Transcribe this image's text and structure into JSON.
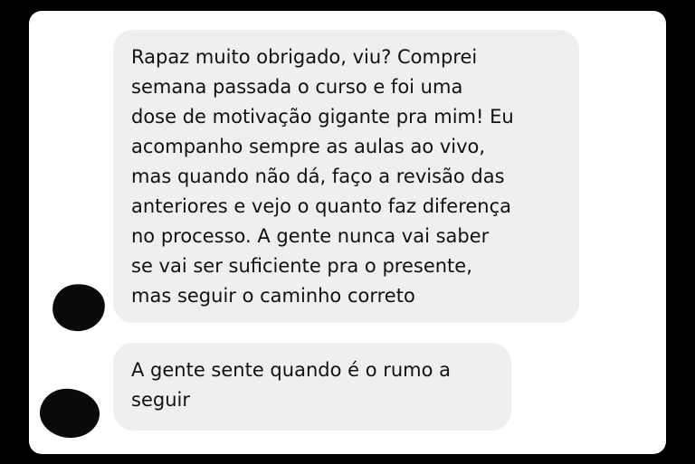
{
  "messages": [
    {
      "lines": [
        "Rapaz muito obrigado, viu? Comprei",
        "semana passada o curso e foi uma",
        "dose de motivação gigante pra mim! Eu",
        "acompanho sempre as aulas ao vivo,",
        "mas quando não dá, faço a revisão das",
        "anteriores e vejo o quanto faz diferença",
        "no processo. A gente nunca vai saber",
        "se vai ser suficiente pra o presente,",
        "mas seguir o caminho correto"
      ]
    },
    {
      "lines": [
        "A gente sente quando é o rumo a",
        "seguir"
      ]
    }
  ],
  "colors": {
    "background": "#000000",
    "panel": "#ffffff",
    "bubble": "#efeff0",
    "text": "#111111",
    "avatar_redaction": "#0a0a0a"
  }
}
